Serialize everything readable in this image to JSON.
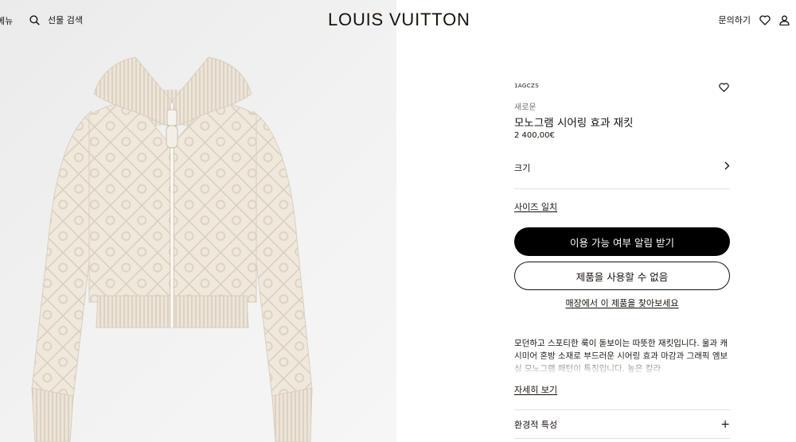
{
  "header": {
    "menu_label": "메뉴",
    "search_label": "선물 검색",
    "logo": "LOUIS VUITTON",
    "contact_label": "문의하기",
    "icons": [
      "search-icon",
      "heart-icon",
      "user-icon"
    ]
  },
  "product": {
    "image_alt": "모노그램 시어링 효과 재킷",
    "sku": "1AGCZS",
    "badge": "새로운",
    "name": "모노그램 시어링 효과 재킷",
    "price": "2 400,00€",
    "size_label": "크기",
    "size_guide_label": "사이즈 일치",
    "notify_button": "이용 가능 여부 알림 받기",
    "unavailable_button": "제품을 사용할 수 없음",
    "store_link": "매장에서 이 제품을 찾아보세요",
    "description": "모던하고 스포티한 룩이 돋보이는 따뜻한 재킷입니다. 울과 캐시미어 혼방 소재로 부드러운 시어링 효과 마감과 그래픽 엠보싱 모노그램 패턴이 특징입니다. 높은 칼라",
    "more_label": "자세히 보기",
    "eco_label": "환경적 특성",
    "eco_icon": "+"
  },
  "colors": {
    "text": "#19110b",
    "button_primary_bg": "#000000",
    "image_bg": "#efefef",
    "jacket": "#efe8dc",
    "divider": "#e1e1e1"
  }
}
